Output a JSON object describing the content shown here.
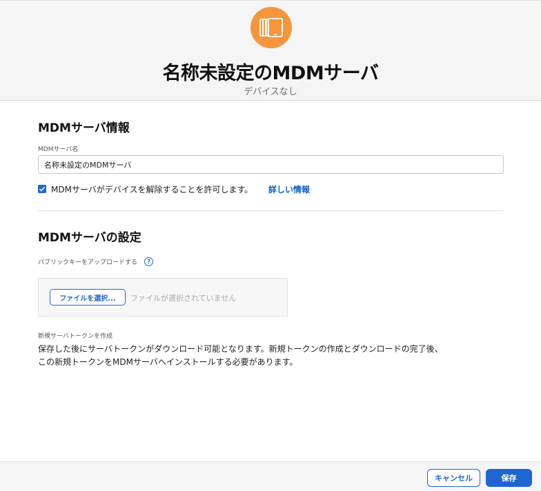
{
  "header": {
    "icon": "ipad-stack-icon",
    "icon_bg_color": "#f5963c",
    "title": "名称未設定のMDMサーバ",
    "subtitle": "デバイスなし"
  },
  "info_section": {
    "title": "MDMサーバ情報",
    "name_label": "MDMサーバ名",
    "name_value": "名称未設定のMDMサーバ",
    "release_checkbox": {
      "checked": true,
      "label": "MDMサーバがデバイスを解除することを許可します。",
      "link": "詳しい情報"
    }
  },
  "settings_section": {
    "title": "MDMサーバの設定",
    "upload_label": "パブリックキーをアップロードする",
    "help_icon": "?",
    "choose_file_label": "ファイルを選択...",
    "no_file_text": "ファイルが選択されていません",
    "token_label": "新規サーバトークンを作成",
    "token_description": "保存した後にサーバトークンがダウンロード可能となります。新規トークンの作成とダウンロードの完了後、この新規トークンをMDMサーバへインストールする必要があります。"
  },
  "footer": {
    "cancel_label": "キャンセル",
    "save_label": "保存"
  },
  "colors": {
    "accent": "#1f66d1",
    "icon_orange": "#f5963c"
  }
}
